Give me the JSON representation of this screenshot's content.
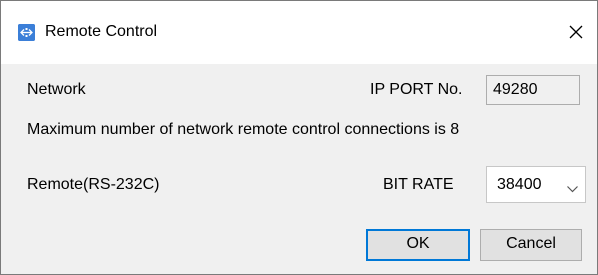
{
  "window": {
    "title": "Remote Control",
    "close_icon": "close-icon",
    "app_icon": "remote-control-app-icon"
  },
  "network": {
    "label": "Network",
    "ip_port_label": "IP PORT No.",
    "ip_port_value": "49280",
    "max_connections_text": "Maximum number of network remote control connections is 8"
  },
  "remote": {
    "label": "Remote(RS-232C)",
    "bit_rate_label": "BIT RATE",
    "bit_rate_value": "38400",
    "dropdown_icon": "chevron-down-icon"
  },
  "buttons": {
    "ok_label": "OK",
    "cancel_label": "Cancel"
  },
  "colors": {
    "accent": "#0078d7",
    "app_icon_bg": "#3b7fd8",
    "dialog_bg": "#f0f0f0"
  }
}
